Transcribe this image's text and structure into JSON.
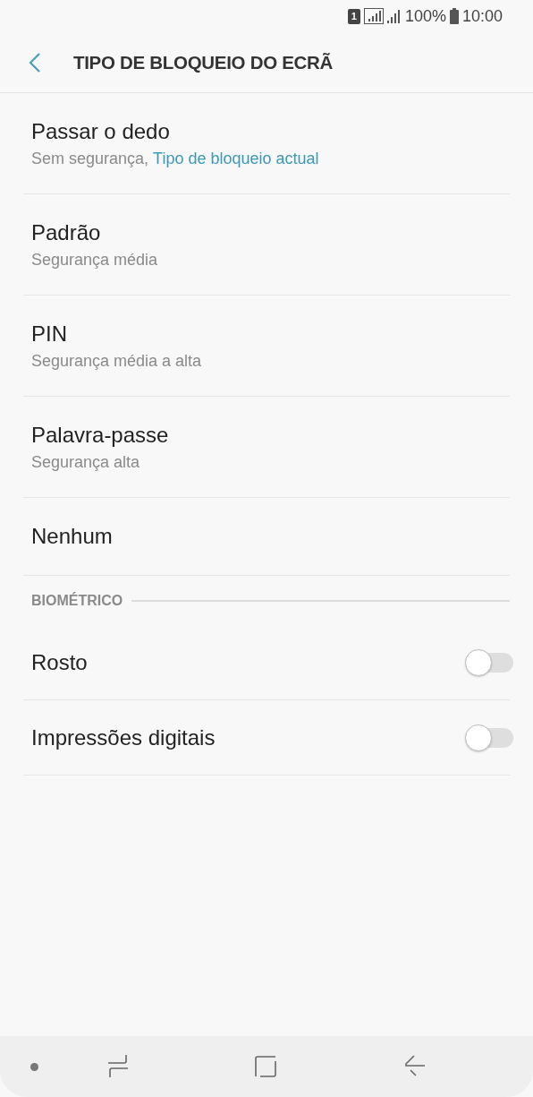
{
  "status_bar": {
    "sim": "1",
    "battery": "100%",
    "time": "10:00"
  },
  "header": {
    "title": "TIPO DE BLOQUEIO DO ECRÃ"
  },
  "items": [
    {
      "kind": "option",
      "title": "Passar o dedo",
      "subtitle": "Sem segurança,",
      "note": "Tipo de bloqueio actual"
    },
    {
      "kind": "option",
      "title": "Padrão",
      "subtitle": "Segurança média"
    },
    {
      "kind": "option",
      "title": "PIN",
      "subtitle": "Segurança média a alta"
    },
    {
      "kind": "option",
      "title": "Palavra-passe",
      "subtitle": "Segurança alta"
    },
    {
      "kind": "option",
      "title": "Nenhum"
    },
    {
      "kind": "section",
      "title": "BIOMÉTRICO"
    },
    {
      "kind": "toggle",
      "title": "Rosto",
      "on": false
    },
    {
      "kind": "toggle",
      "title": "Impressões digitais",
      "on": false
    }
  ]
}
